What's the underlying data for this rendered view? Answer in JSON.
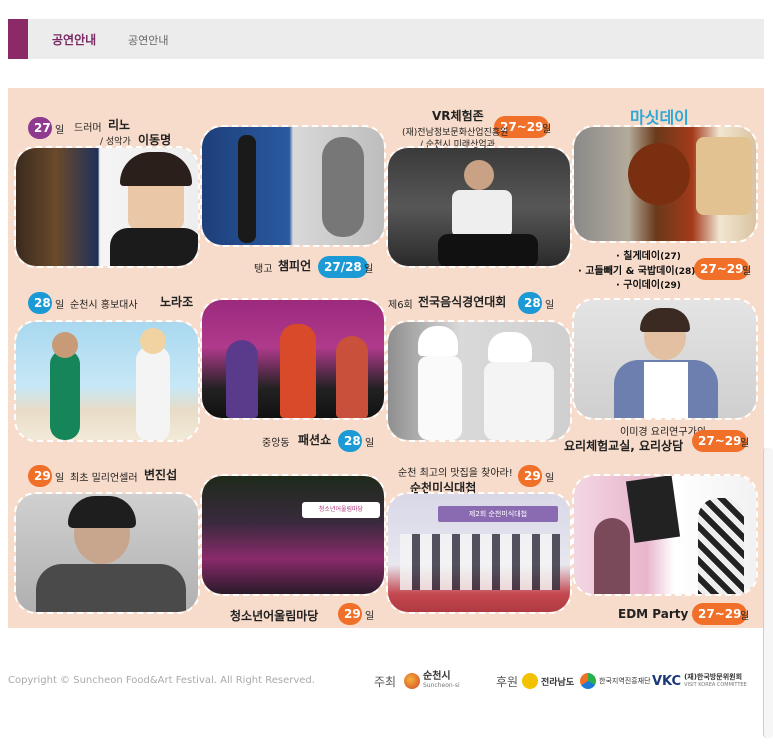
{
  "header": {
    "title": "공연안내",
    "breadcrumb": "공연안내"
  },
  "poster": {
    "row1": {
      "p1": {
        "badge": "27",
        "day": "일",
        "line1": "드러머",
        "name1": "리노",
        "line2": "/ 성악가",
        "name2": "이동명"
      },
      "p2": {
        "label": "탱고",
        "name": "챔피언",
        "badge": "27/28",
        "day": "일"
      },
      "p3": {
        "title": "VR체험존",
        "badge": "27~29",
        "day": "일",
        "sub1": "(재)전남정보문화산업진흥원",
        "sub2": "/ 순천시 미래산업과"
      },
      "p4": {
        "title": "마싯데이",
        "item1": "칠게데이",
        "item1_day": "(27)",
        "item2": "고들빼기 & 국밥데이",
        "item2_day": "(28)",
        "item3": "구이데이",
        "item3_day": "(29)",
        "badge": "27~29",
        "day": "일"
      }
    },
    "row2": {
      "p1": {
        "badge": "28",
        "day": "일",
        "label": "순천시 홍보대사",
        "name": "노라조"
      },
      "p2": {
        "label": "중앙동",
        "name": "패션쇼",
        "badge": "28",
        "day": "일"
      },
      "p3": {
        "label": "제6회",
        "name": "전국음식경연대회",
        "badge": "28",
        "day": "일"
      },
      "p4": {
        "label": "이미경 요리연구가의",
        "name": "요리체험교실, 요리상담",
        "badge": "27~29",
        "day": "일"
      }
    },
    "row3": {
      "p1": {
        "badge": "29",
        "day": "일",
        "label": "최초 밀리언셀러",
        "name": "변진섭"
      },
      "p2": {
        "name": "청소년어울림마당",
        "badge": "29",
        "day": "일",
        "sign": "청소년어울림마당"
      },
      "p3": {
        "label": "순천 최고의 맛집을 찾아라!",
        "name": "순천미식대첩",
        "badge": "29",
        "day": "일",
        "banner": "제2회 순천미식대첩"
      },
      "p4": {
        "name": "EDM Party",
        "badge": "27~29",
        "day": "일"
      }
    }
  },
  "footer": {
    "copyright": "Copyright © Suncheon Food&Art Festival. All Right Reserved.",
    "host_label": "주최",
    "host": "순천시",
    "host_sub": "Suncheon-si",
    "sponsor_label": "후원",
    "sponsors": [
      "전라남도",
      "한국지역진흥재단",
      "VKC",
      "(재)한국방문위원회"
    ],
    "sponsor_sub": "VISIT KOREA COMMITTEE"
  },
  "colors": {
    "accent": "#8b2a67",
    "poster_bg": "#f8dccb",
    "badge_purple": "#8e3a8f",
    "badge_blue": "#1c9ad6",
    "badge_orange": "#f0702a"
  }
}
